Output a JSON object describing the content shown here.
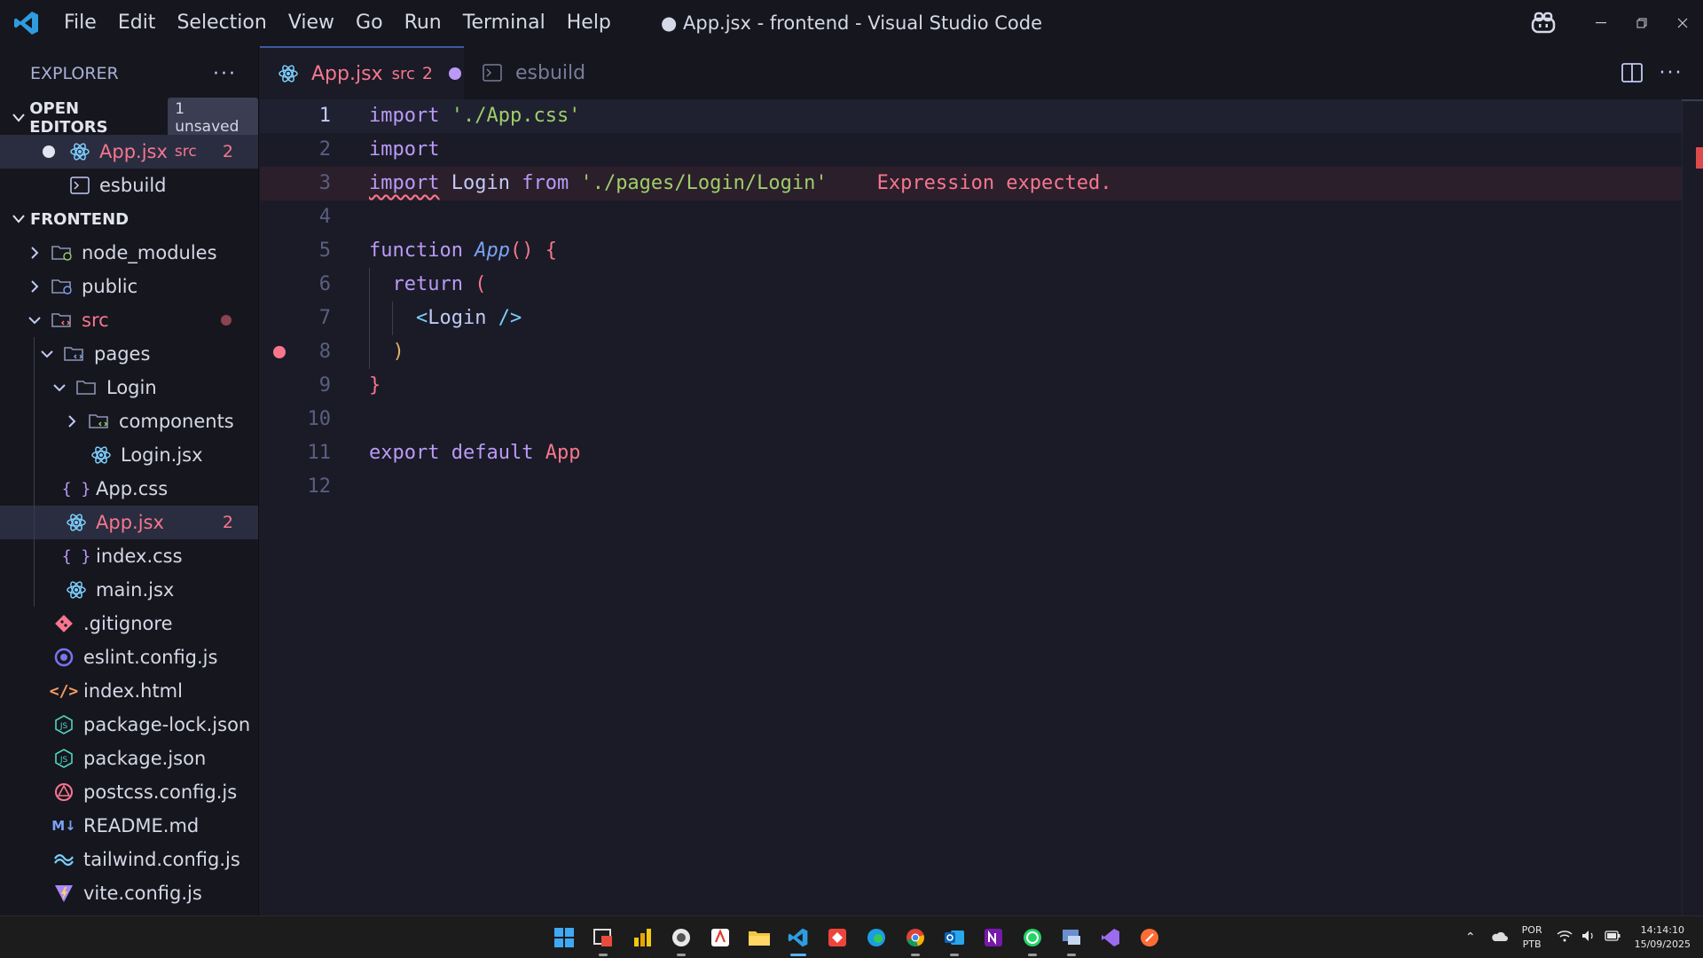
{
  "titlebar": {
    "menu": [
      "File",
      "Edit",
      "Selection",
      "View",
      "Go",
      "Run",
      "Terminal",
      "Help"
    ],
    "window_title": "● App.jsx - frontend - Visual Studio Code"
  },
  "sidebar": {
    "explorer_label": "EXPLORER",
    "open_editors": {
      "label": "OPEN EDITORS",
      "badge": "1 unsaved",
      "items": [
        {
          "name": "App.jsx",
          "desc": "src",
          "count": "2"
        },
        {
          "name": "esbuild"
        }
      ]
    },
    "folder": {
      "label": "FRONTEND",
      "items": [
        {
          "name": "node_modules"
        },
        {
          "name": "public"
        },
        {
          "name": "src"
        },
        {
          "name": "pages"
        },
        {
          "name": "Login"
        },
        {
          "name": "components"
        },
        {
          "name": "Login.jsx"
        },
        {
          "name": "App.css"
        },
        {
          "name": "App.jsx",
          "count": "2"
        },
        {
          "name": "index.css"
        },
        {
          "name": "main.jsx"
        },
        {
          "name": ".gitignore"
        },
        {
          "name": "eslint.config.js"
        },
        {
          "name": "index.html"
        },
        {
          "name": "package-lock.json"
        },
        {
          "name": "package.json"
        },
        {
          "name": "postcss.config.js"
        },
        {
          "name": "README.md"
        },
        {
          "name": "tailwind.config.js"
        },
        {
          "name": "vite.config.js"
        }
      ]
    }
  },
  "tabs": [
    {
      "label": "App.jsx",
      "desc": "src",
      "count": "2",
      "active": true
    },
    {
      "label": "esbuild",
      "active": false
    }
  ],
  "editor": {
    "line_numbers": [
      "1",
      "2",
      "3",
      "4",
      "5",
      "6",
      "7",
      "8",
      "9",
      "10",
      "11",
      "12"
    ],
    "lines": {
      "l1": {
        "kw": "import",
        "str": "'./App.css'"
      },
      "l2": {
        "kw": "import"
      },
      "l3": {
        "kw": "import",
        "id": "Login",
        "kw2": "from",
        "str": "'./pages/Login/Login'",
        "diagnostic": "Expression expected."
      },
      "l5": {
        "kw": "function",
        "fn": "App",
        "rest": "() {"
      },
      "l6": {
        "kw": "return",
        "rest": "("
      },
      "l7": {
        "open": "<",
        "tag": "Login",
        "close": "/>"
      },
      "l8": {
        "rest": ")"
      },
      "l9": {
        "rest": "}"
      },
      "l11": {
        "kw": "export",
        "kw2": "default",
        "id": "App"
      }
    }
  },
  "tray": {
    "lang_top": "POR",
    "lang_bottom": "PTB",
    "time": "14:14:10",
    "date": "15/09/2025"
  },
  "colors": {
    "accent": "#3d59a1",
    "error": "#f7768e",
    "background": "#1a1b26"
  }
}
